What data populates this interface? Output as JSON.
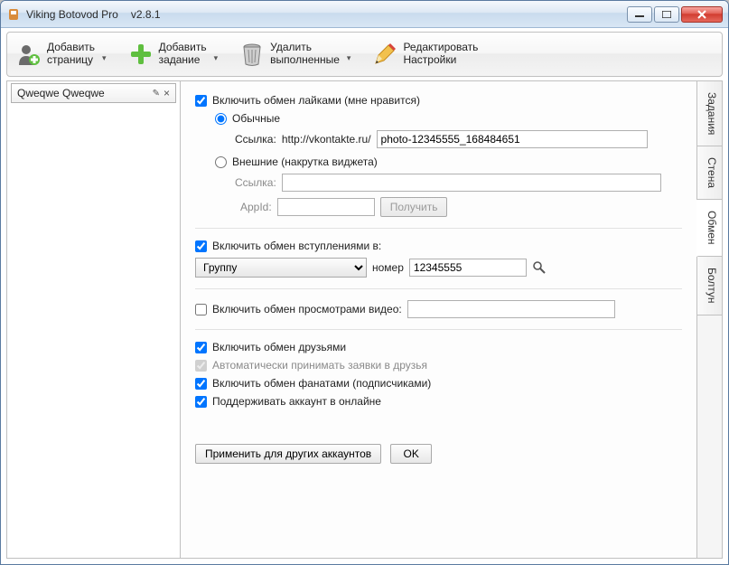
{
  "titlebar": {
    "app_name": "Viking Botovod Pro",
    "version": "v2.8.1"
  },
  "toolbar": {
    "add_page": {
      "line1": "Добавить",
      "line2": "страницу"
    },
    "add_task": {
      "line1": "Добавить",
      "line2": "задание"
    },
    "delete_done": {
      "line1": "Удалить",
      "line2": "выполненные"
    },
    "edit_settings": {
      "line1": "Редактировать",
      "line2": "Настройки"
    }
  },
  "account": {
    "name": "Qweqwe Qweqwe"
  },
  "side_tabs": {
    "tasks": "Задания",
    "wall": "Стена",
    "exchange": "Обмен",
    "boltun": "Болтун"
  },
  "main": {
    "likes": {
      "enable": "Включить обмен лайками (мне нравится)",
      "normal": "Обычные",
      "link_label": "Ссылка:",
      "link_prefix": "http://vkontakte.ru/",
      "link_value": "photo-12345555_168484651",
      "external": "Внешние (накрутка виджета)",
      "ext_link_label": "Ссылка:",
      "ext_link_value": "",
      "appid_label": "AppId:",
      "appid_value": "",
      "get_btn": "Получить"
    },
    "groups": {
      "enable": "Включить обмен вступлениями в:",
      "select_value": "Группу",
      "number_label": "номер",
      "number_value": "12345555"
    },
    "video": {
      "enable": "Включить обмен просмотрами видео:",
      "value": ""
    },
    "friends": {
      "enable": "Включить обмен друзьями",
      "auto_accept": "Автоматически принимать заявки в друзья",
      "fans": "Включить обмен фанатами (подписчиками)",
      "online": "Поддерживать аккаунт в онлайне"
    },
    "buttons": {
      "apply_all": "Применить для других аккаунтов",
      "ok": "OK"
    }
  }
}
